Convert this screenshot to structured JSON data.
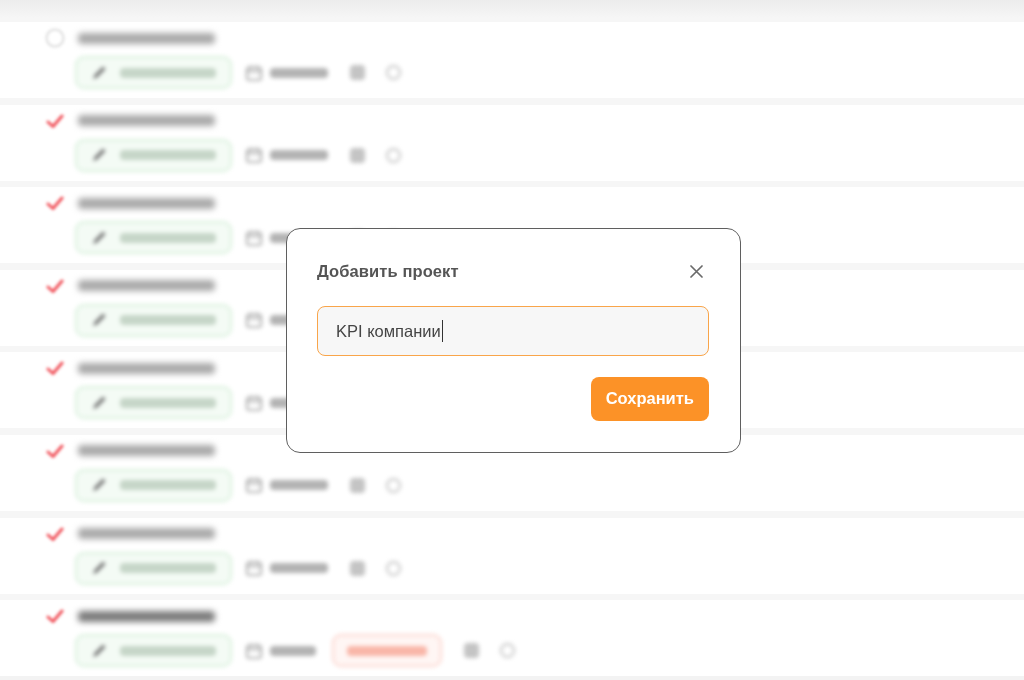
{
  "task_list": {
    "rows": [
      {
        "done": false,
        "overdue": false
      },
      {
        "done": true,
        "overdue": false
      },
      {
        "done": true,
        "overdue": false
      },
      {
        "done": true,
        "overdue": false
      },
      {
        "done": true,
        "overdue": false
      },
      {
        "done": true,
        "overdue": false
      },
      {
        "done": true,
        "overdue": false
      },
      {
        "done": true,
        "overdue": true
      }
    ]
  },
  "dialog": {
    "title": "Добавить проект",
    "input": {
      "value": "KPI компании",
      "focused": true
    },
    "save_button": {
      "label": "Сохранить"
    }
  }
}
